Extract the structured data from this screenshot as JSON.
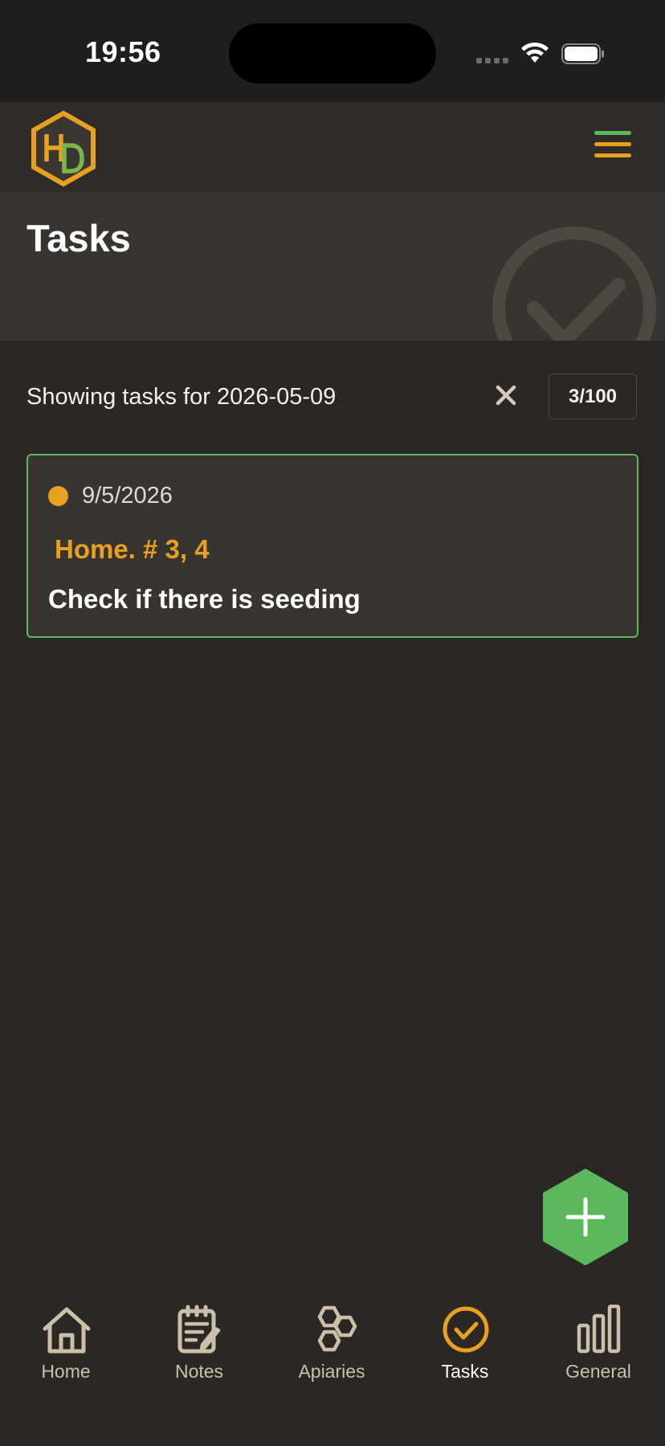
{
  "status_bar": {
    "time": "19:56",
    "icons": [
      "cellular-signal-icon",
      "wifi-icon",
      "battery-icon"
    ]
  },
  "header": {
    "logo_text": "HD",
    "menu_icon": "hamburger-menu-icon"
  },
  "banner": {
    "title": "Tasks",
    "background_icon": "checkmark-circle-icon"
  },
  "filter": {
    "text": "Showing tasks for 2026-05-09",
    "clear_icon": "close-icon",
    "count": "3/100"
  },
  "tasks": [
    {
      "date": "9/5/2026",
      "location": "Home. # 3, 4",
      "text": "Check if there is seeding",
      "status_color": "#e8a021"
    }
  ],
  "fab": {
    "icon": "plus-icon"
  },
  "nav": {
    "items": [
      {
        "label": "Home",
        "icon": "home-icon",
        "active": false
      },
      {
        "label": "Notes",
        "icon": "notes-icon",
        "active": false
      },
      {
        "label": "Apiaries",
        "icon": "hexagon-cells-icon",
        "active": false
      },
      {
        "label": "Tasks",
        "icon": "check-circle-icon",
        "active": true
      },
      {
        "label": "General",
        "icon": "bar-chart-icon",
        "active": false
      }
    ]
  },
  "colors": {
    "accent_orange": "#e8a021",
    "accent_green": "#5cb85c",
    "background": "#2a2725",
    "nav_inactive": "#cbbfa9"
  }
}
